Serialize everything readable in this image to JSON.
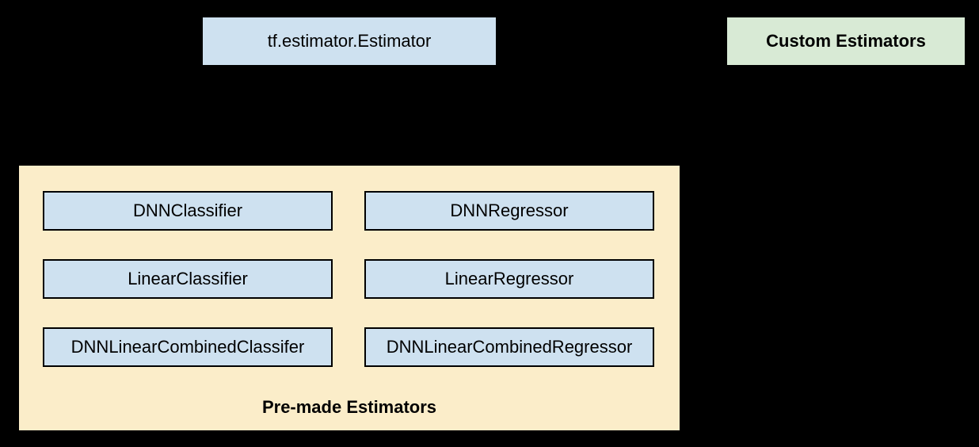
{
  "root": {
    "label": "tf.estimator.Estimator"
  },
  "custom": {
    "label": "Custom Estimators"
  },
  "premade": {
    "title": "Pre-made Estimators",
    "items": [
      "DNNClassifier",
      "DNNRegressor",
      "LinearClassifier",
      "LinearRegressor",
      "DNNLinearCombinedClassifer",
      "DNNLinearCombinedRegressor"
    ]
  }
}
